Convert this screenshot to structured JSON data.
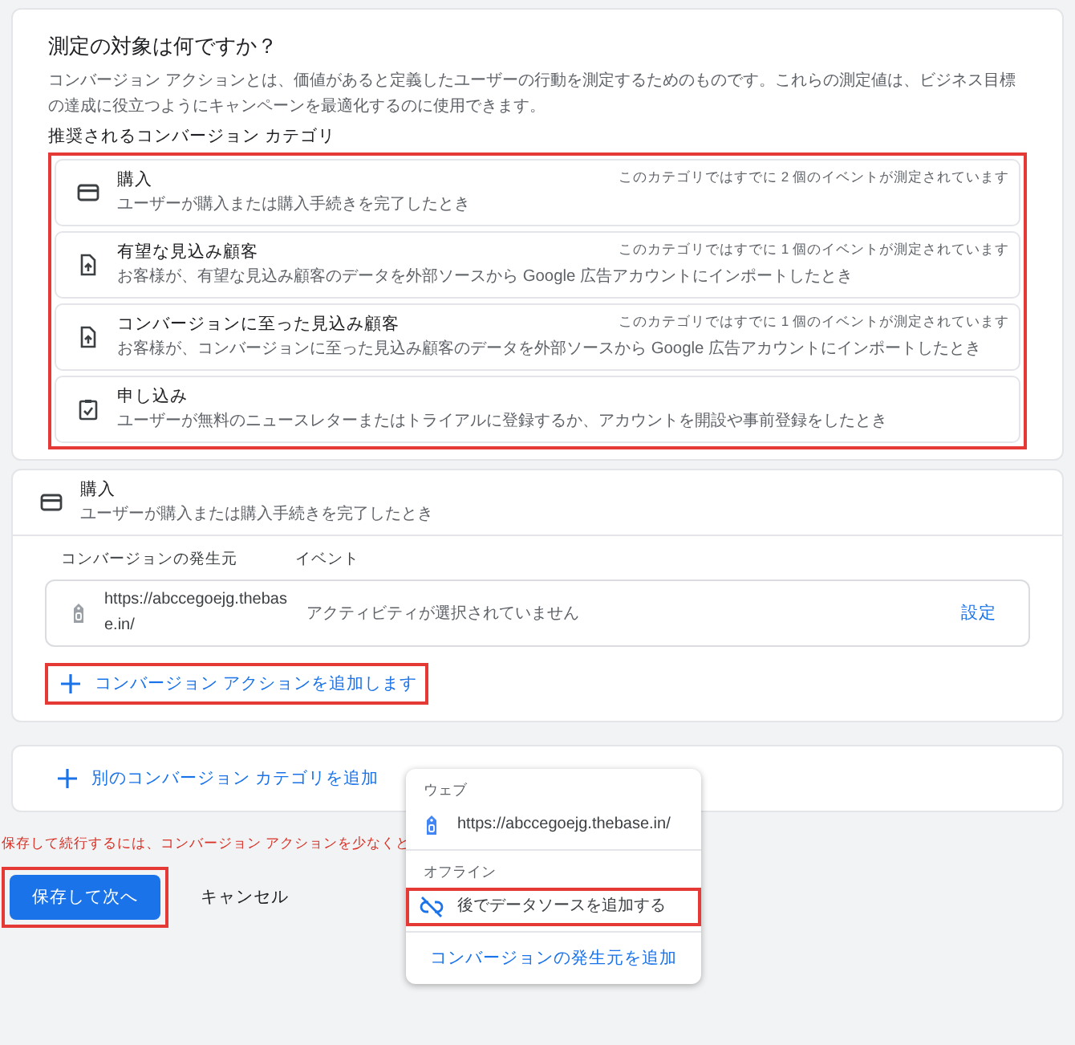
{
  "question": {
    "title": "測定の対象は何ですか？",
    "description": "コンバージョン アクションとは、価値があると定義したユーザーの行動を測定するためのものです。これらの測定値は、ビジネス目標の達成に役立つようにキャンペーンを最適化するのに使用できます。",
    "subheading": "推奨されるコンバージョン カテゴリ"
  },
  "categories_highlighted": true,
  "categories": [
    {
      "kind": "card",
      "title": "購入",
      "description": "ユーザーが購入または購入手続きを完了したとき",
      "count": "このカテゴリではすでに 2 個のイベントが測定されています"
    },
    {
      "kind": "upload",
      "title": "有望な見込み顧客",
      "description": "お客様が、有望な見込み顧客のデータを外部ソースから Google 広告アカウントにインポートしたとき",
      "count": "このカテゴリではすでに 1 個のイベントが測定されています"
    },
    {
      "kind": "upload",
      "title": "コンバージョンに至った見込み顧客",
      "description": "お客様が、コンバージョンに至った見込み顧客のデータを外部ソースから Google 広告アカウントにインポートしたとき",
      "count": "このカテゴリではすでに 1 個のイベントが測定されています"
    },
    {
      "kind": "checklist",
      "title": "申し込み",
      "description": "ユーザーが無料のニュースレターまたはトライアルに登録するか、アカウントを開設や事前登録をしたとき"
    }
  ],
  "selected_category": {
    "kind": "card",
    "title": "購入",
    "description": "ユーザーが購入または購入手続きを完了したとき",
    "columns": [
      "コンバージョンの発生元",
      "イベント"
    ],
    "rows": [
      {
        "source": "https://abccegoejg.thebase.in/",
        "event": "アクティビティが選択されていません",
        "action": "設定"
      }
    ],
    "add_action": {
      "label": "コンバージョン アクションを追加します",
      "highlighted": true
    }
  },
  "add_category": {
    "label": "別のコンバージョン カテゴリを追加"
  },
  "error": "保存して続行するには、コンバージョン アクションを少なくと",
  "buttons": [
    {
      "kind": "primary",
      "label": "保存して次へ",
      "highlighted": true
    },
    {
      "kind": "text",
      "label": "キャンセル",
      "highlighted": false
    }
  ],
  "menu": {
    "sections": [
      {
        "heading": "ウェブ",
        "items": [
          {
            "kind": "tag",
            "label": "https://abccegoejg.thebase.in/",
            "highlighted": false
          }
        ]
      },
      {
        "heading": "オフライン",
        "items": [
          {
            "kind": "unlink",
            "label": "後でデータソースを追加する",
            "highlighted": true
          }
        ]
      }
    ],
    "footer": "コンバージョンの発生元を追加"
  }
}
